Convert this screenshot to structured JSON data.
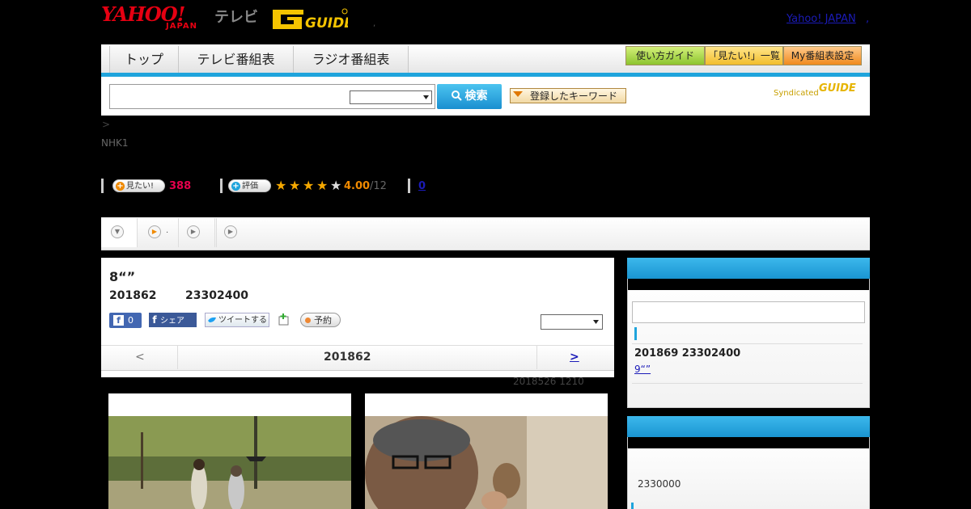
{
  "header": {
    "logo_yahoo": "YAHOO!",
    "logo_japan": "JAPAN",
    "logo_tv": "テレビ",
    "logo_gguide": "GUIDE",
    "yahoo_japan_link": "Yahoo! JAPAN",
    "dot": ",",
    "mid_dot": ","
  },
  "nav": {
    "tabs": [
      "トップ",
      "テレビ番組表",
      "ラジオ番組表"
    ],
    "buttons": [
      "使い方ガイド",
      "「見たい!」一覧",
      "My番組表設定"
    ]
  },
  "search": {
    "button_label": "検索",
    "keyword_button_label": "登録したキーワード",
    "syndicated_label": "Syndicated",
    "syndicated_logo": "GUIDE"
  },
  "breadcrumb": ">",
  "channel": "NHK1",
  "stats": {
    "want_label": "見たい!",
    "want_count": "388",
    "rating_label": "評価",
    "rating_value": "4.00",
    "rating_count": "/12",
    "rating_stars": 4,
    "comment_count": "0"
  },
  "tabstrip": {
    "tab2_text": "."
  },
  "program": {
    "title": "8“”",
    "date": "201862",
    "time": "23302400",
    "fb_like_count": "0",
    "fb_share": "シェア",
    "tweet": "ツイートする",
    "reserve": "予約"
  },
  "date_nav": {
    "prev": "<",
    "current": "201862",
    "next": ">"
  },
  "updated": "2018526  1210",
  "sidebar": {
    "next_date": "201869  23302400",
    "next_title": "9“”",
    "info_text": "2330000"
  },
  "colors": {
    "accent_blue": "#1fa4dc",
    "want_red": "#e6004c",
    "rating_orange": "#f08a00",
    "yahoo_red": "#e60012"
  }
}
